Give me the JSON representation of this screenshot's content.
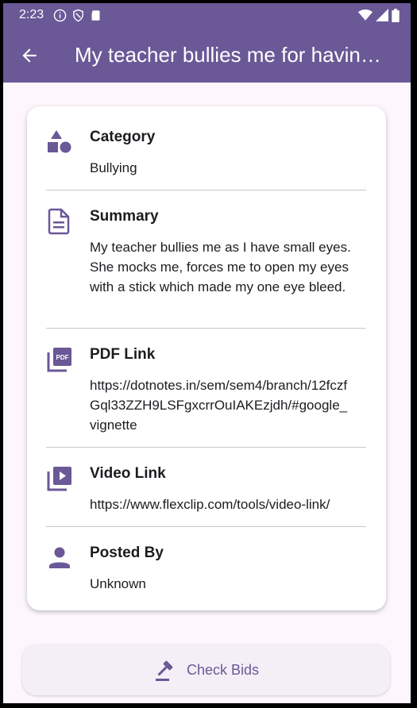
{
  "status_bar": {
    "time": "2:23"
  },
  "app_bar": {
    "title": "My teacher bullies me for having small eyes"
  },
  "details": {
    "category": {
      "label": "Category",
      "value": "Bullying"
    },
    "summary": {
      "label": "Summary",
      "value": "My teacher bullies me as I have small eyes. She mocks me, forces me to open my eyes with a stick which made my one eye bleed."
    },
    "pdf_link": {
      "label": "PDF Link",
      "value": "https://dotnotes.in/sem/sem4/branch/12fczfGql33ZZH9LSFgxcrrOuIAKEzjdh/#google_vignette"
    },
    "video_link": {
      "label": "Video Link",
      "value": "https://www.flexclip.com/tools/video-link/"
    },
    "posted_by": {
      "label": "Posted By",
      "value": "Unknown"
    }
  },
  "check_bids_label": "Check Bids",
  "icons": [
    "shapes-icon",
    "document-icon",
    "pdf-icon",
    "video-library-icon",
    "person-icon",
    "gavel-icon",
    "back-arrow-icon"
  ],
  "colors": {
    "accent": "#6a5897",
    "background": "#fdf7fd",
    "card": "#ffffff"
  }
}
